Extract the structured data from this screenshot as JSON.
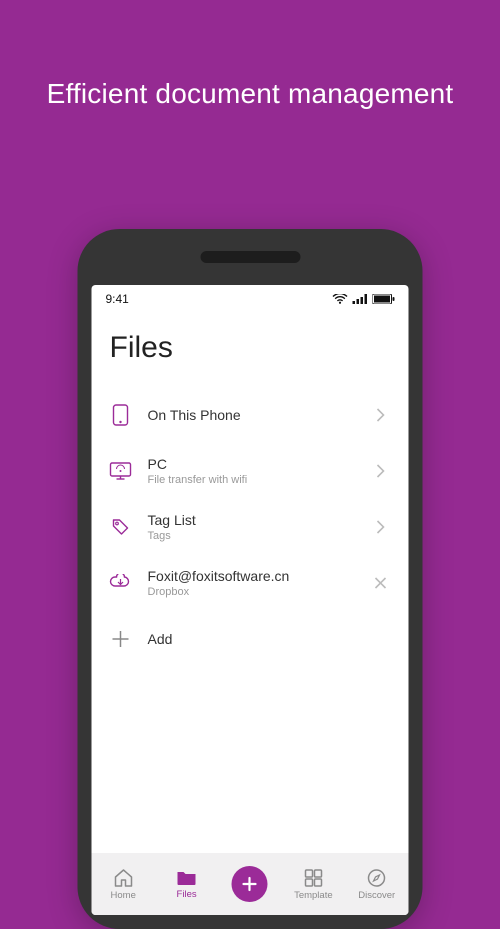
{
  "headline": "Efficient document management",
  "statusbar": {
    "time": "9:41"
  },
  "page": {
    "title": "Files"
  },
  "rows": [
    {
      "label": "On This Phone",
      "sub": "",
      "icon": "phone-icon",
      "action": "chevron"
    },
    {
      "label": "PC",
      "sub": "File transfer with wifi",
      "icon": "pc-icon",
      "action": "chevron"
    },
    {
      "label": "Tag List",
      "sub": "Tags",
      "icon": "tag-icon",
      "action": "chevron"
    },
    {
      "label": "Foxit@foxitsoftware.cn",
      "sub": "Dropbox",
      "icon": "dropbox-icon",
      "action": "close"
    },
    {
      "label": "Add",
      "sub": "",
      "icon": "plus-icon",
      "action": ""
    }
  ],
  "tabs": {
    "home": "Home",
    "files": "Files",
    "template": "Template",
    "discover": "Discover"
  }
}
